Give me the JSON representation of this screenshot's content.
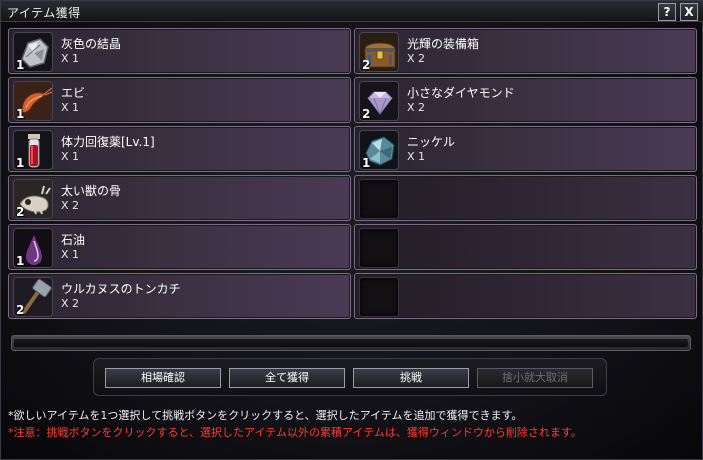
{
  "window": {
    "title": "アイテム獲得",
    "help_label": "?",
    "close_label": "X"
  },
  "items_left": [
    {
      "name": "灰色の結晶",
      "count": "X 1",
      "qty": "1",
      "icon": "gray-crystal-icon"
    },
    {
      "name": "エビ",
      "count": "X 1",
      "qty": "1",
      "icon": "shrimp-icon"
    },
    {
      "name": "体力回復薬[Lv.1]",
      "count": "X 1",
      "qty": "1",
      "icon": "health-potion-icon"
    },
    {
      "name": "太い獣の骨",
      "count": "X 2",
      "qty": "2",
      "icon": "beast-bone-icon"
    },
    {
      "name": "石油",
      "count": "X 1",
      "qty": "1",
      "icon": "oil-drop-icon"
    },
    {
      "name": "ウルカヌスのトンカチ",
      "count": "X 2",
      "qty": "2",
      "icon": "hammer-icon"
    }
  ],
  "items_right": [
    {
      "name": "光輝の装備箱",
      "count": "X 2",
      "qty": "2",
      "icon": "treasure-chest-icon"
    },
    {
      "name": "小さなダイヤモンド",
      "count": "X 2",
      "qty": "2",
      "icon": "diamond-icon"
    },
    {
      "name": "ニッケル",
      "count": "X 1",
      "qty": "1",
      "icon": "nickel-ore-icon"
    }
  ],
  "buttons": {
    "market": "相場確認",
    "take_all": "全て獲得",
    "challenge": "挑戦",
    "cancel_small_big": "捨小就大取消"
  },
  "notes": {
    "line1": "*欲しいアイテムを1つ選択して挑戦ボタンをクリックすると、選択したアイテムを追加で獲得できます。",
    "line2": "*注意：挑戦ボタンをクリックすると、選択したアイテム以外の累積アイテムは、獲得ウィンドウから削除されます。"
  },
  "colors": {
    "warning": "#ff3b2f",
    "slot_border": "#7a6f80"
  }
}
